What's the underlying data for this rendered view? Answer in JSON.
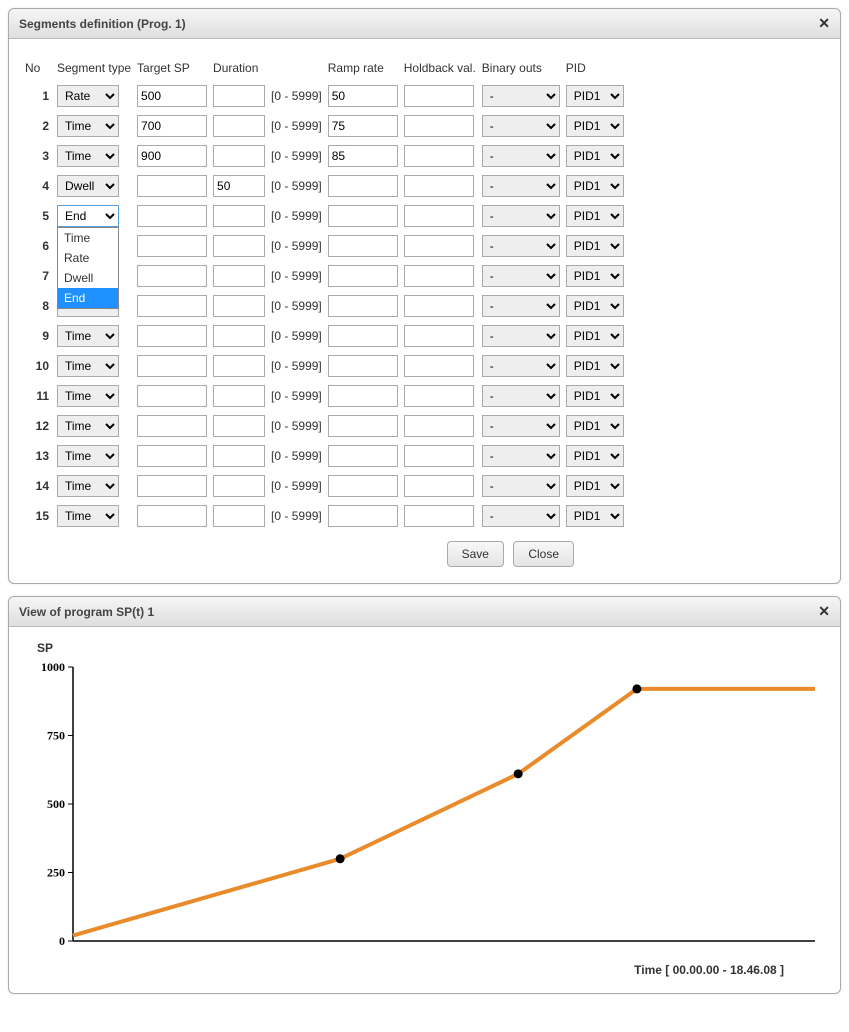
{
  "panel1": {
    "title": "Segments definition (Prog. 1)",
    "headers": {
      "no": "No",
      "segType": "Segment type",
      "targetSP": "Target SP",
      "duration": "Duration",
      "rampRate": "Ramp rate",
      "holdback": "Holdback val.",
      "binaryOuts": "Binary outs",
      "pid": "PID"
    },
    "durationRange": "[0 - 5999]",
    "segTypeOptions": [
      "Time",
      "Rate",
      "Dwell",
      "End"
    ],
    "dropdownHighlight": "End",
    "rows": [
      {
        "no": 1,
        "segType": "Rate",
        "targetSP": "500",
        "duration": "",
        "ramp": "50",
        "hold": "",
        "bout": "-",
        "pid": "PID1"
      },
      {
        "no": 2,
        "segType": "Time",
        "targetSP": "700",
        "duration": "",
        "ramp": "75",
        "hold": "",
        "bout": "-",
        "pid": "PID1"
      },
      {
        "no": 3,
        "segType": "Time",
        "targetSP": "900",
        "duration": "",
        "ramp": "85",
        "hold": "",
        "bout": "-",
        "pid": "PID1"
      },
      {
        "no": 4,
        "segType": "Dwell",
        "targetSP": "",
        "duration": "50",
        "ramp": "",
        "hold": "",
        "bout": "-",
        "pid": "PID1"
      },
      {
        "no": 5,
        "segType": "End",
        "targetSP": "",
        "duration": "",
        "ramp": "",
        "hold": "",
        "bout": "-",
        "pid": "PID1",
        "open": true
      },
      {
        "no": 6,
        "segType": "",
        "targetSP": "",
        "duration": "",
        "ramp": "",
        "hold": "",
        "bout": "-",
        "pid": "PID1"
      },
      {
        "no": 7,
        "segType": "",
        "targetSP": "",
        "duration": "",
        "ramp": "",
        "hold": "",
        "bout": "-",
        "pid": "PID1"
      },
      {
        "no": 8,
        "segType": "",
        "targetSP": "",
        "duration": "",
        "ramp": "",
        "hold": "",
        "bout": "-",
        "pid": "PID1"
      },
      {
        "no": 9,
        "segType": "Time",
        "targetSP": "",
        "duration": "",
        "ramp": "",
        "hold": "",
        "bout": "-",
        "pid": "PID1"
      },
      {
        "no": 10,
        "segType": "Time",
        "targetSP": "",
        "duration": "",
        "ramp": "",
        "hold": "",
        "bout": "-",
        "pid": "PID1"
      },
      {
        "no": 11,
        "segType": "Time",
        "targetSP": "",
        "duration": "",
        "ramp": "",
        "hold": "",
        "bout": "-",
        "pid": "PID1"
      },
      {
        "no": 12,
        "segType": "Time",
        "targetSP": "",
        "duration": "",
        "ramp": "",
        "hold": "",
        "bout": "-",
        "pid": "PID1"
      },
      {
        "no": 13,
        "segType": "Time",
        "targetSP": "",
        "duration": "",
        "ramp": "",
        "hold": "",
        "bout": "-",
        "pid": "PID1"
      },
      {
        "no": 14,
        "segType": "Time",
        "targetSP": "",
        "duration": "",
        "ramp": "",
        "hold": "",
        "bout": "-",
        "pid": "PID1"
      },
      {
        "no": 15,
        "segType": "Time",
        "targetSP": "",
        "duration": "",
        "ramp": "",
        "hold": "",
        "bout": "-",
        "pid": "PID1"
      }
    ],
    "buttons": {
      "save": "Save",
      "close": "Close"
    }
  },
  "panel2": {
    "title": "View of program SP(t) 1",
    "yLabel": "SP",
    "xLabel": "Time [ 00.00.00 - 18.46.08 ]"
  },
  "chart_data": {
    "type": "line",
    "title": "View of program SP(t) 1",
    "xlabel": "Time [ 00.00.00 - 18.46.08 ]",
    "ylabel": "SP",
    "ylim": [
      0,
      1000
    ],
    "yticks": [
      0,
      250,
      500,
      750,
      1000
    ],
    "series": [
      {
        "name": "SP(t)",
        "color": "#e98b2a",
        "points_xfrac": [
          0.0,
          0.36,
          0.6,
          0.76,
          1.0
        ],
        "values": [
          20,
          300,
          610,
          920,
          920
        ]
      }
    ],
    "markers_xfrac": [
      0.36,
      0.6,
      0.76
    ],
    "markers_values": [
      300,
      610,
      920
    ]
  }
}
